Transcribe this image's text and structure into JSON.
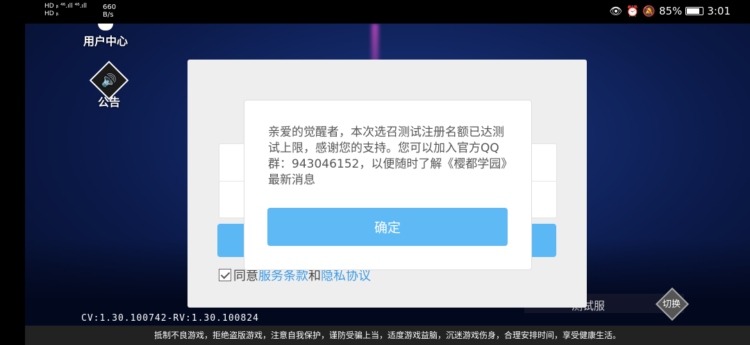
{
  "status_bar": {
    "network_top": "HD ᵦ ⁴⁶.ıll ⁴⁶.ıll",
    "network_bottom": "HD ᵦ",
    "speed_value": "660",
    "speed_unit": "B/s",
    "battery_percent": "85%",
    "time": "3:01",
    "battery_level": 0.85,
    "icons": [
      "eye-icon",
      "alarm-icon",
      "mute-icon",
      "battery-icon"
    ]
  },
  "side_menu": {
    "user_center": "用户中心",
    "announcement": "公告"
  },
  "login_panel": {
    "agree_prefix": "同意",
    "terms": "服务条款",
    "and": "和",
    "privacy": "隐私协议",
    "checkbox_checked": true
  },
  "dialog": {
    "message": "亲爱的觉醒者，本次选召测试注册名额已达测试上限，感谢您的支持。您可以加入官方QQ群：943046152，以便随时了解《樱都学园》最新消息",
    "confirm": "确定"
  },
  "server": {
    "name": "测试服",
    "switch": "切换"
  },
  "version": "CV:1.30.100742-RV:1.30.100824",
  "footer_notice": "抵制不良游戏，拒绝盗版游戏，注意自我保护，谨防受骗上当，适度游戏益脑，沉迷游戏伤身，合理安排时间，享受健康生活。",
  "colors": {
    "accent_blue": "#5fb9f4",
    "link_blue": "#3b9be4"
  }
}
